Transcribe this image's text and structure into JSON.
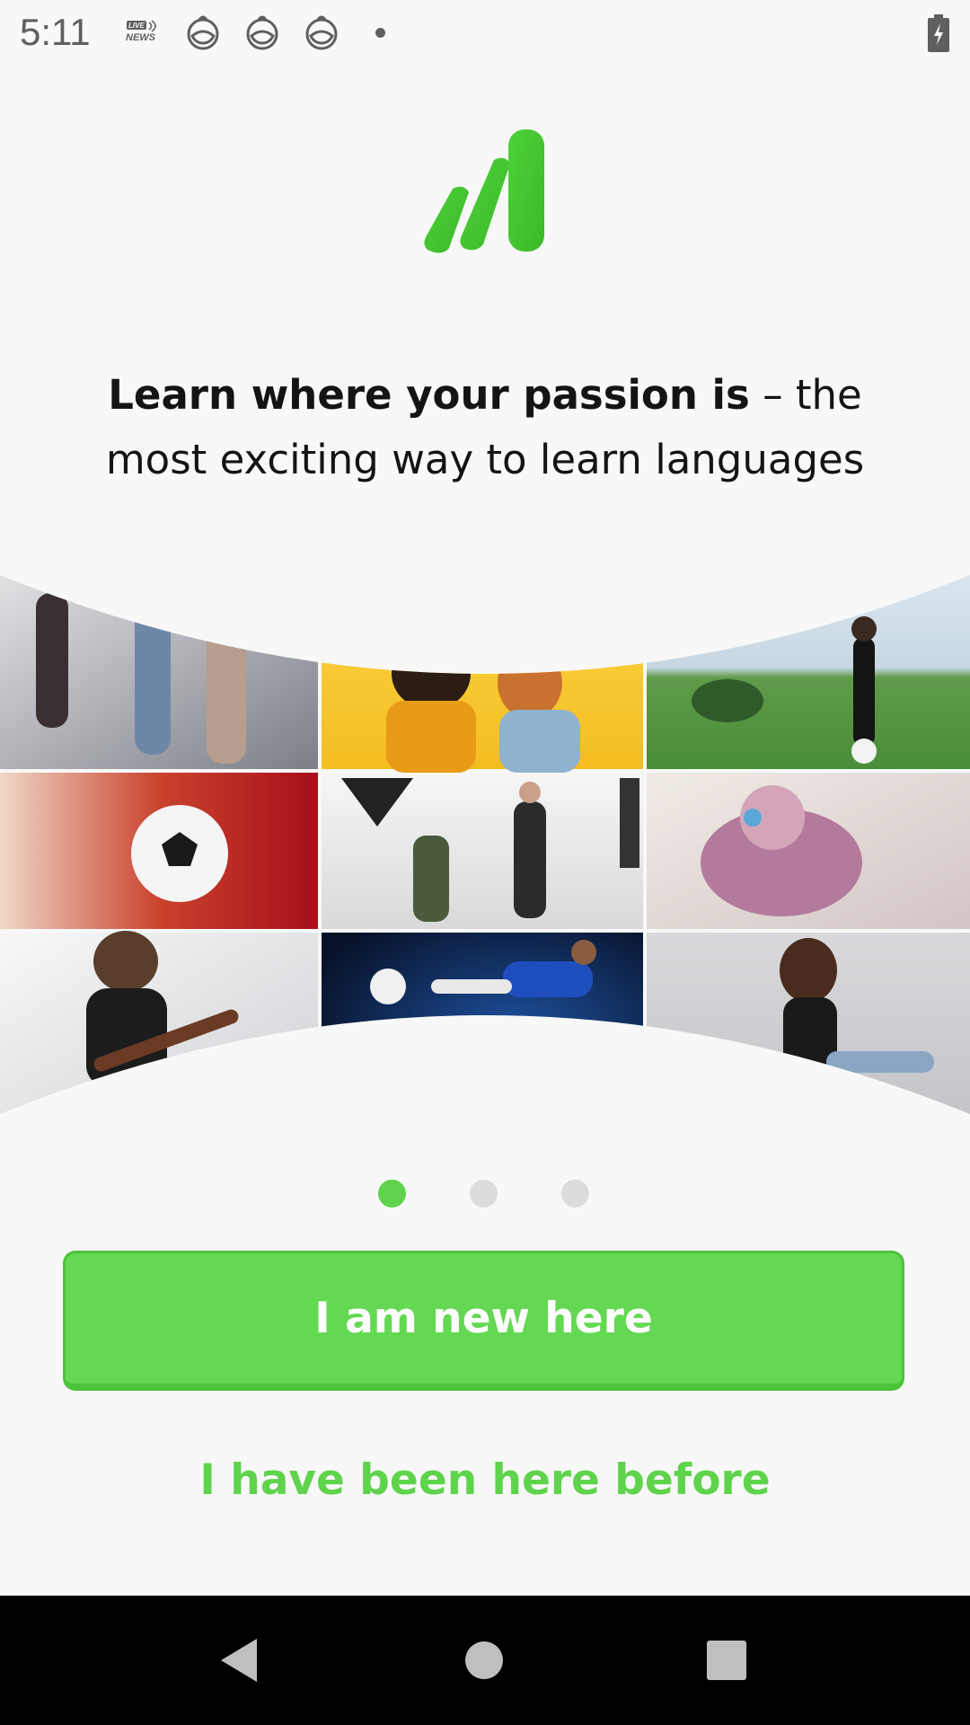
{
  "status_bar": {
    "time": "5:11",
    "live_news_badge": "LIVE NEWS",
    "icons": [
      "live-news-icon",
      "baby-icon",
      "baby-icon",
      "baby-icon",
      "notification-dot-icon",
      "battery-charging-icon"
    ]
  },
  "logo": {
    "name": "bars-logo-icon",
    "color": "#43c22f"
  },
  "headline": {
    "bold": "Learn where your passion is",
    "rest_line1": " – the",
    "rest_line2": "most exciting way to learn languages"
  },
  "collage": {
    "tiles": [
      "Fashion runway models",
      "Two women singing into microphone",
      "Man kicking soccer ball on field",
      "Player holding soccer ball in stadium",
      "Photographer in studio with model",
      "Woman with headphones on bed",
      "Man playing electric guitar",
      "Soccer player kicking ball",
      "Woman sitting on floor"
    ]
  },
  "pager": {
    "pages": 3,
    "current": 1
  },
  "buttons": {
    "new_here": "I am new here",
    "been_here": "I have been here before"
  },
  "colors": {
    "accent": "#64d853",
    "accent_dark": "#4dc23b",
    "link": "#5fd34c",
    "background": "#f8f8f8",
    "text": "#141414"
  },
  "nav_bar": {
    "icons": [
      "back-icon",
      "home-icon",
      "recents-icon"
    ]
  }
}
